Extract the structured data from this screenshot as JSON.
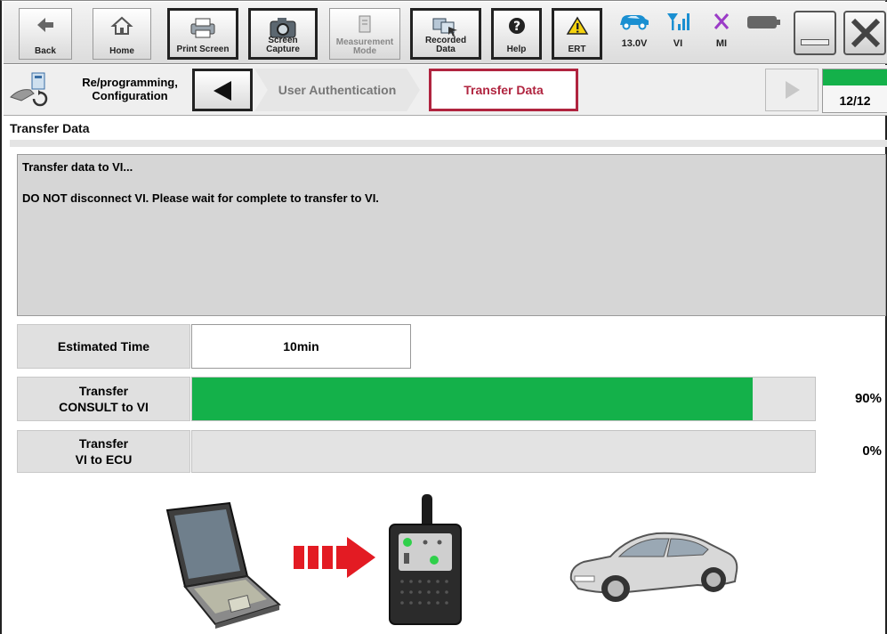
{
  "toolbar": {
    "back_label": "Back",
    "home_label": "Home",
    "print_screen_label": "Print Screen",
    "screen_capture_label_1": "Screen",
    "screen_capture_label_2": "Capture",
    "measurement_mode_label_1": "Measurement",
    "measurement_mode_label_2": "Mode",
    "recorded_data_label_1": "Recorded",
    "recorded_data_label_2": "Data",
    "help_label": "Help",
    "ert_label": "ERT",
    "battery_voltage": "13.0V",
    "vi_label": "VI",
    "mi_label": "MI"
  },
  "breadcrumb": {
    "mode_line_1": "Re/programming,",
    "mode_line_2": "Configuration",
    "step_user_auth": "User Authentication",
    "step_transfer": "Transfer Data",
    "step_count": "12/12",
    "step_progress": 1.0
  },
  "section_title": "Transfer Data",
  "message": {
    "line1": "Transfer data to VI...",
    "line2": "DO NOT disconnect VI. Please wait for complete to transfer to VI."
  },
  "estimated": {
    "label": "Estimated Time",
    "value": "10min"
  },
  "transfers": [
    {
      "label_1": "Transfer",
      "label_2": "CONSULT to VI",
      "percent": 90,
      "percent_text": "90%"
    },
    {
      "label_1": "Transfer",
      "label_2": "VI to ECU",
      "percent": 0,
      "percent_text": "0%"
    }
  ],
  "colors": {
    "progress_fill": "#14b14a",
    "active_step_border": "#b0243f",
    "active_step_text": "#b0243f",
    "mi_x": "#9b3bc7",
    "vi_signal": "#1a8fd1"
  },
  "icons": [
    "back-arrow-icon",
    "home-icon",
    "printer-icon",
    "camera-icon",
    "measurement-icon",
    "recorded-data-icon",
    "help-icon",
    "warning-icon",
    "car-battery-icon",
    "vi-signal-icon",
    "mi-x-icon",
    "battery-icon",
    "minimize-icon",
    "close-icon",
    "reprogram-icon",
    "prev-arrow-icon",
    "next-arrow-icon",
    "laptop-icon",
    "transfer-arrow-icon",
    "vi-device-icon",
    "car-icon"
  ]
}
